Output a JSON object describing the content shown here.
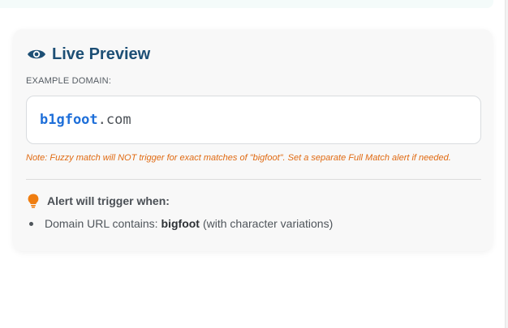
{
  "preview": {
    "title": "Live Preview",
    "icon": "eye-icon",
    "accent_color": "#1d4f75",
    "field_label": "EXAMPLE DOMAIN:",
    "domain_name": "b1gfoot",
    "domain_tld": ".com",
    "note": "Note: Fuzzy match will NOT trigger for exact matches of \"bigfoot\". Set a separate Full Match alert if needed.",
    "note_color": "#e06a12"
  },
  "trigger": {
    "icon": "lightbulb-icon",
    "title": "Alert will trigger when:",
    "condition_prefix": "Domain URL contains:",
    "condition_keyword": "bigfoot",
    "condition_suffix": "(with character variations)"
  }
}
